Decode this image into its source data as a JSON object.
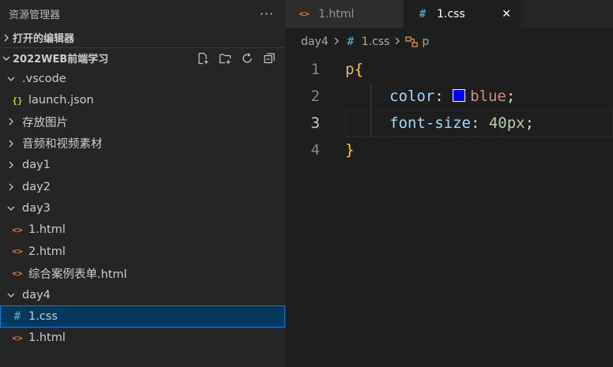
{
  "sidebar": {
    "title": "资源管理器",
    "more": "···",
    "open_editors": "打开的编辑器",
    "workspace": "2022WEB前端学习",
    "tree": [
      {
        "label": ".vscode",
        "type": "folder",
        "open": true,
        "level": 0
      },
      {
        "label": "launch.json",
        "type": "json",
        "level": 1
      },
      {
        "label": "存放图片",
        "type": "folder",
        "open": false,
        "level": 0
      },
      {
        "label": "音频和视频素材",
        "type": "folder",
        "open": false,
        "level": 0
      },
      {
        "label": "day1",
        "type": "folder",
        "open": false,
        "level": 0
      },
      {
        "label": "day2",
        "type": "folder",
        "open": false,
        "level": 0
      },
      {
        "label": "day3",
        "type": "folder",
        "open": true,
        "level": 0
      },
      {
        "label": "1.html",
        "type": "html",
        "level": 1
      },
      {
        "label": "2.html",
        "type": "html",
        "level": 1
      },
      {
        "label": "综合案例表单.html",
        "type": "html",
        "level": 1
      },
      {
        "label": "day4",
        "type": "folder",
        "open": true,
        "level": 0
      },
      {
        "label": "1.css",
        "type": "css",
        "level": 1,
        "selected": true
      },
      {
        "label": "1.html",
        "type": "html",
        "level": 1
      }
    ]
  },
  "tabs": [
    {
      "label": "1.html",
      "icon": "html-file-icon",
      "active": false
    },
    {
      "label": "1.css",
      "icon": "css-file-icon",
      "active": true,
      "close": "✕"
    }
  ],
  "breadcrumb": {
    "folder": "day4",
    "file": "1.css",
    "symbol": "p"
  },
  "editor": {
    "lines": [
      {
        "num": "1"
      },
      {
        "num": "2"
      },
      {
        "num": "3"
      },
      {
        "num": "4"
      }
    ],
    "current_line": 3,
    "tokens": {
      "selector": "p",
      "open_brace": "{",
      "close_brace": "}",
      "prop1": "color",
      "colon": ":",
      "value1": "blue",
      "semi": ";",
      "prop2": "font-size",
      "value2": "40px"
    },
    "swatch_color": "#0000ff"
  }
}
